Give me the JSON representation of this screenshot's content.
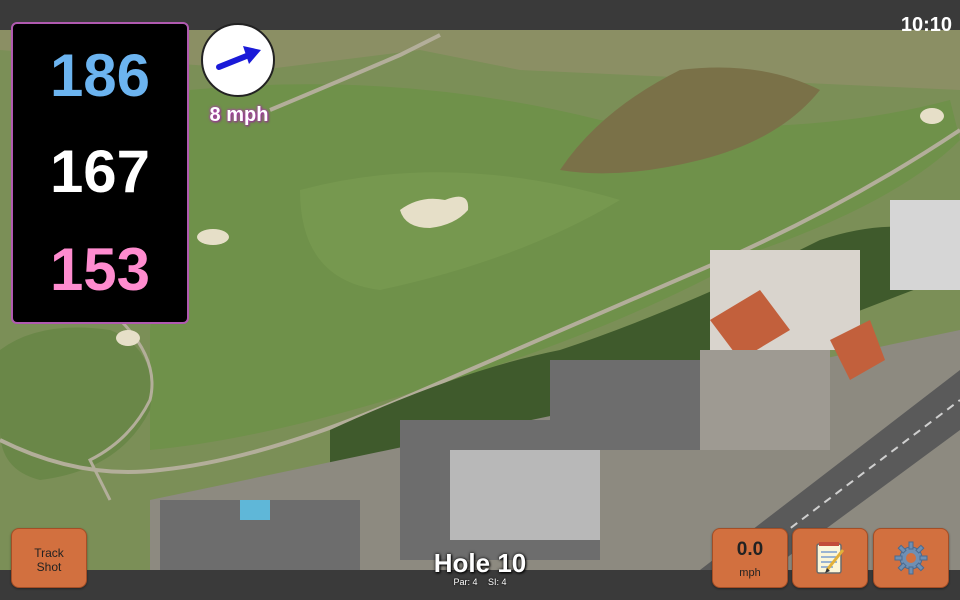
{
  "status": {
    "time": "10:10"
  },
  "yardages": {
    "back": "186",
    "middle": "167",
    "front": "153"
  },
  "wind": {
    "speed": "8 mph",
    "direction_icon": "wind-arrow-icon"
  },
  "hole": {
    "title": "Hole 10",
    "par": "Par: 4",
    "stroke_index": "SI: 4"
  },
  "buttons": {
    "track_shot": {
      "line1": "Track",
      "line2": "Shot"
    },
    "speed": {
      "value": "0.0",
      "unit": "mph"
    },
    "notes_icon": "notepad-icon",
    "settings_icon": "gear-icon"
  },
  "colors": {
    "back": "#6cb4f0",
    "middle": "#ffffff",
    "front": "#ff8ccf",
    "button": "#d2703f",
    "panel_border": "#b05ab0"
  }
}
